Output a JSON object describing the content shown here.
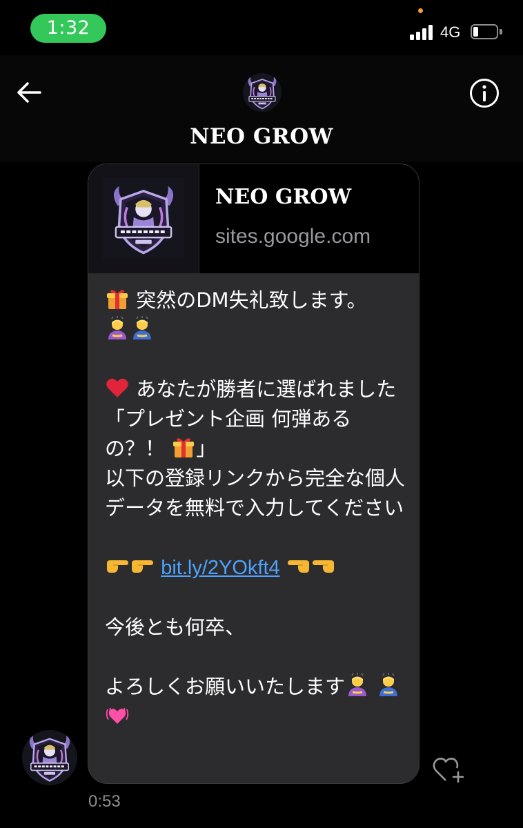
{
  "status": {
    "time": "1:32",
    "network": "4G"
  },
  "header": {
    "title": "NEO GROW"
  },
  "link_card": {
    "title": "NEO GROW",
    "domain": "sites.google.com"
  },
  "message": {
    "line1": "突然のDM失礼致します。",
    "line2": "あなたが勝者に選ばれました　「プレゼント企画 何弾あるの？！",
    "line2_end": "」",
    "line3": "以下の登録リンクから完全な個人データを無料で入力してください",
    "link": "bit.ly/2YOkft4",
    "line4": "今後とも何卒、",
    "line5": "よろしくお願いいたします"
  },
  "timestamp": "0:53",
  "icons": [
    "back-arrow-icon",
    "info-icon",
    "heart-plus-icon",
    "gift-emoji",
    "bowing-person-emoji",
    "red-heart-emoji",
    "pointing-right-emoji",
    "pointing-left-emoji",
    "beating-heart-emoji"
  ],
  "colors": {
    "time_pill": "#34c759",
    "link": "#4da3ff",
    "bubble": "#2c2c2e"
  }
}
